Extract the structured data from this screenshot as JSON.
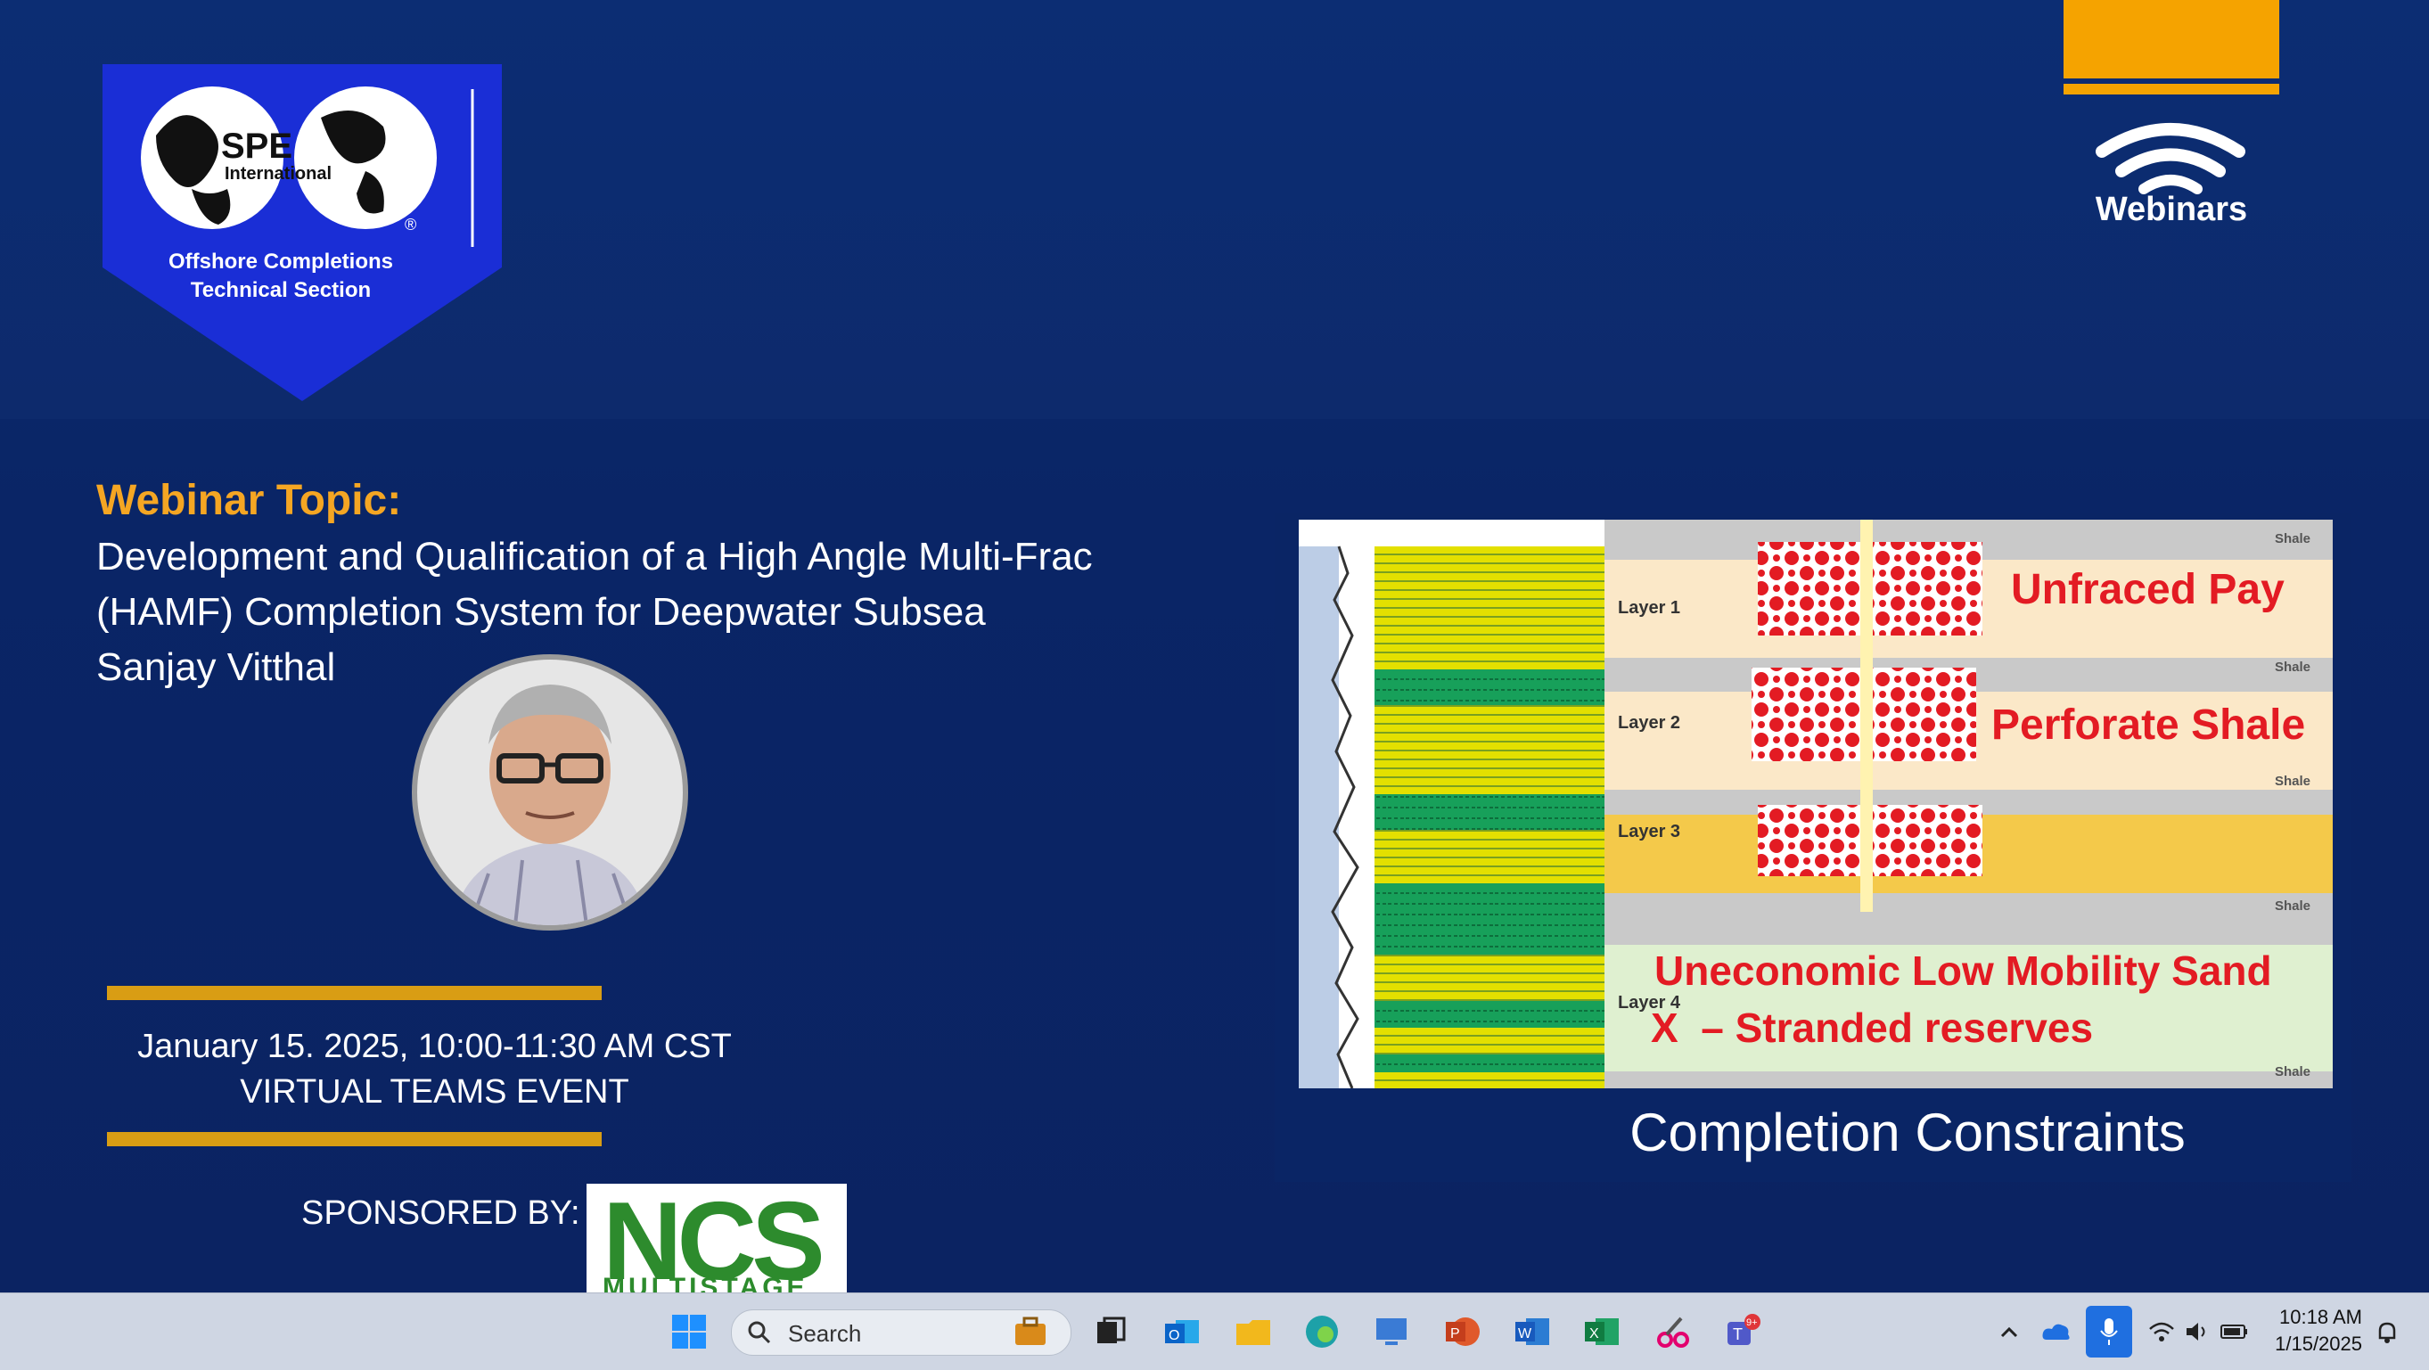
{
  "logo": {
    "brand": "SPE",
    "brand_sub": "International",
    "section_line1": "Offshore Completions",
    "section_line2": "Technical Section",
    "registered": "®",
    "shield_color": "#1a2ed6"
  },
  "webinars_logo": {
    "label": "Webinars",
    "accent": "#f5a300"
  },
  "topic": {
    "heading": "Webinar Topic:",
    "line1": "Development and Qualification of a High Angle Multi-Frac",
    "line2": "(HAMF) Completion System for Deepwater Subsea",
    "speaker": "Sanjay Vitthal"
  },
  "event": {
    "date": "January 15. 2025, 10:00-11:30 AM CST",
    "format": "VIRTUAL TEAMS EVENT",
    "sponsored_by": "SPONSORED BY:",
    "sponsor_logo": "NCS",
    "sponsor_logo_sub": "MULTISTAGE"
  },
  "diagram": {
    "caption": "Completion Constraints",
    "layer1": "Layer 1",
    "layer2": "Layer 2",
    "layer3": "Layer 3",
    "layer4": "Layer 4",
    "shale": "Shale",
    "unfraced": "Unfraced Pay",
    "perforate": "Perforate Shale",
    "uneconomic": "Uneconomic Low Mobility Sand",
    "stranded": "X  – Stranded reserves"
  },
  "taskbar": {
    "search_placeholder": "Search",
    "time": "10:18 AM",
    "date": "1/15/2025",
    "notification_badge": "9+",
    "apps": [
      "start-icon",
      "search-icon",
      "work-icon",
      "task-view-icon",
      "outlook-icon",
      "file-explorer-icon",
      "edge-icon",
      "remote-desktop-icon",
      "powerpoint-icon",
      "word-icon",
      "excel-icon",
      "snipping-tool-icon",
      "teams-icon"
    ]
  }
}
